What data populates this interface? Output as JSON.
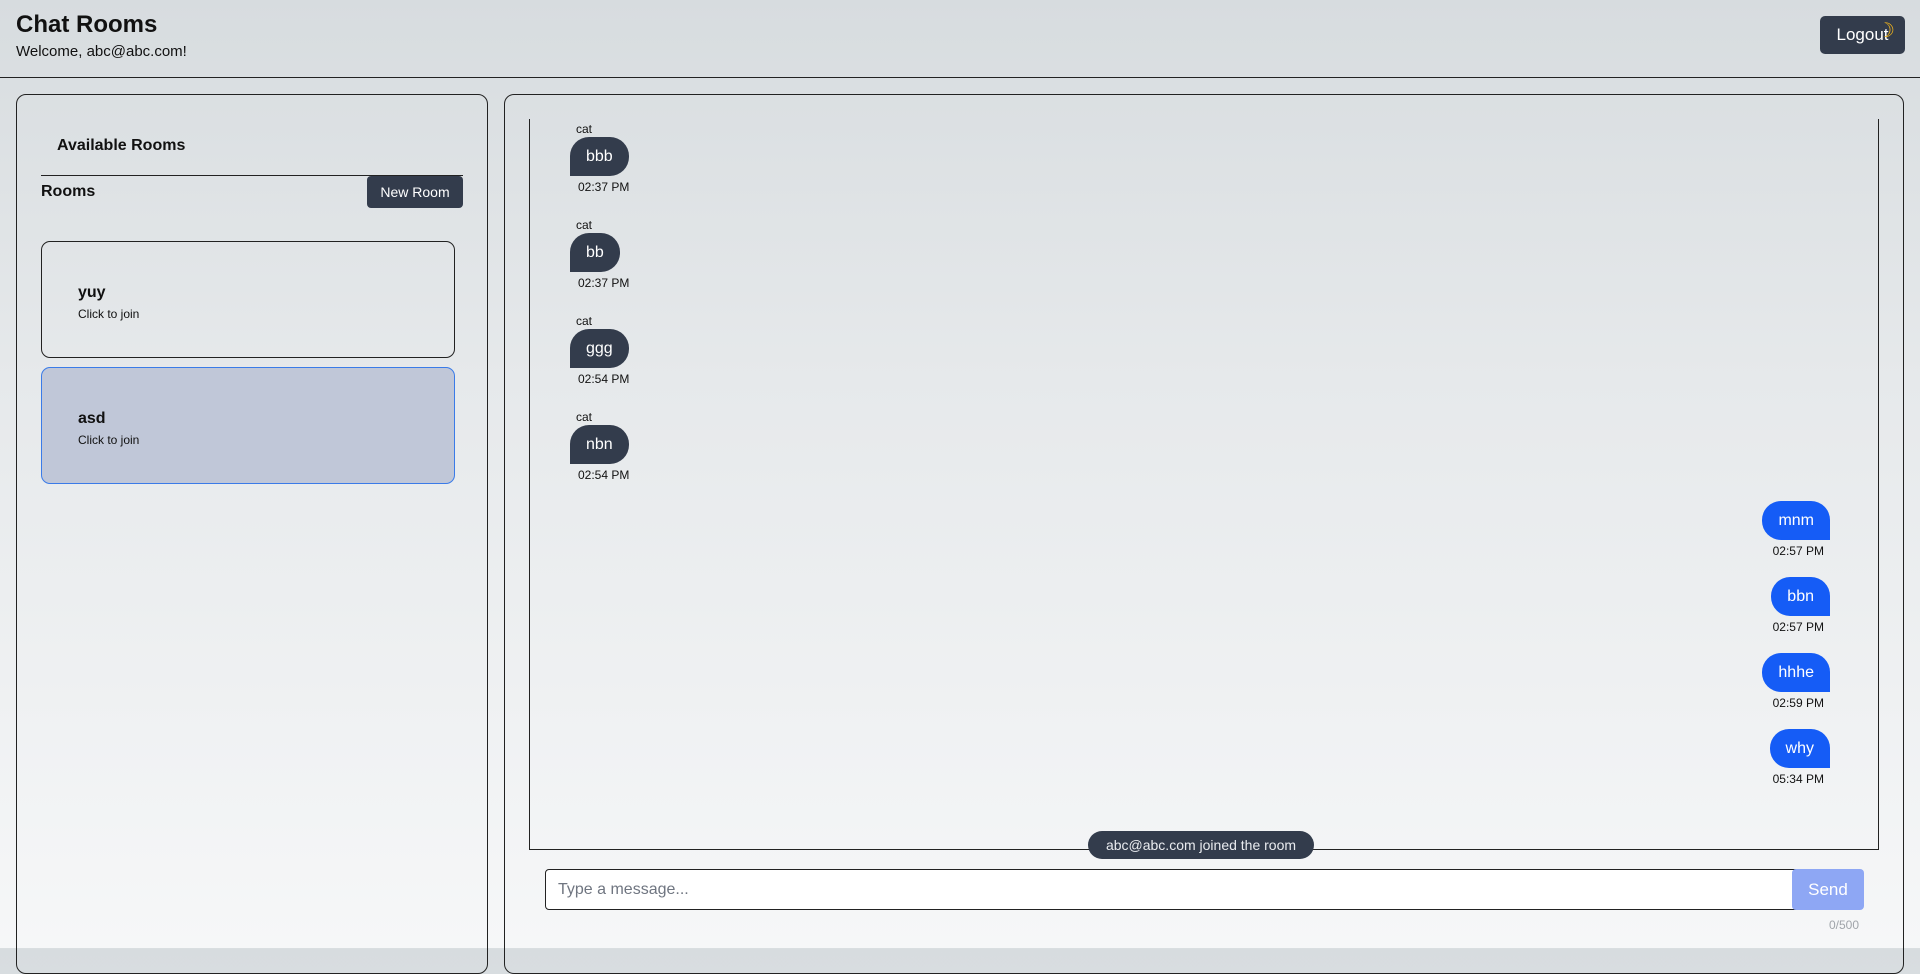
{
  "header": {
    "title": "Chat Rooms",
    "welcome": "Welcome, abc@abc.com!",
    "logout_label": "Logout",
    "theme_icon": "moon-icon"
  },
  "sidebar": {
    "section_title": "Available Rooms",
    "rooms_label": "Rooms",
    "new_room_label": "New Room",
    "rooms": [
      {
        "name": "yuy",
        "subtitle": "Click to join",
        "selected": false
      },
      {
        "name": "asd",
        "subtitle": "Click to join",
        "selected": true
      }
    ]
  },
  "chat": {
    "incoming": [
      {
        "sender": "cat",
        "text": "bbb",
        "time": "02:37 PM"
      },
      {
        "sender": "cat",
        "text": "bb",
        "time": "02:37 PM"
      },
      {
        "sender": "cat",
        "text": "ggg",
        "time": "02:54 PM"
      },
      {
        "sender": "cat",
        "text": "nbn",
        "time": "02:54 PM"
      }
    ],
    "outgoing": [
      {
        "text": "mnm",
        "time": "02:57 PM"
      },
      {
        "text": "bbn",
        "time": "02:57 PM"
      },
      {
        "text": "hhhe",
        "time": "02:59 PM"
      },
      {
        "text": "why",
        "time": "05:34 PM"
      }
    ],
    "system_message": "abc@abc.com joined the room",
    "input_placeholder": "Type a message...",
    "input_value": "",
    "send_label": "Send",
    "char_count": "0/500"
  },
  "colors": {
    "primary_dark": "#333c4c",
    "outgoing_bubble": "#155cf6",
    "send_disabled": "#8ea7f4",
    "selected_room_bg": "#c0c7d8",
    "selected_room_border": "#3a7be8"
  }
}
